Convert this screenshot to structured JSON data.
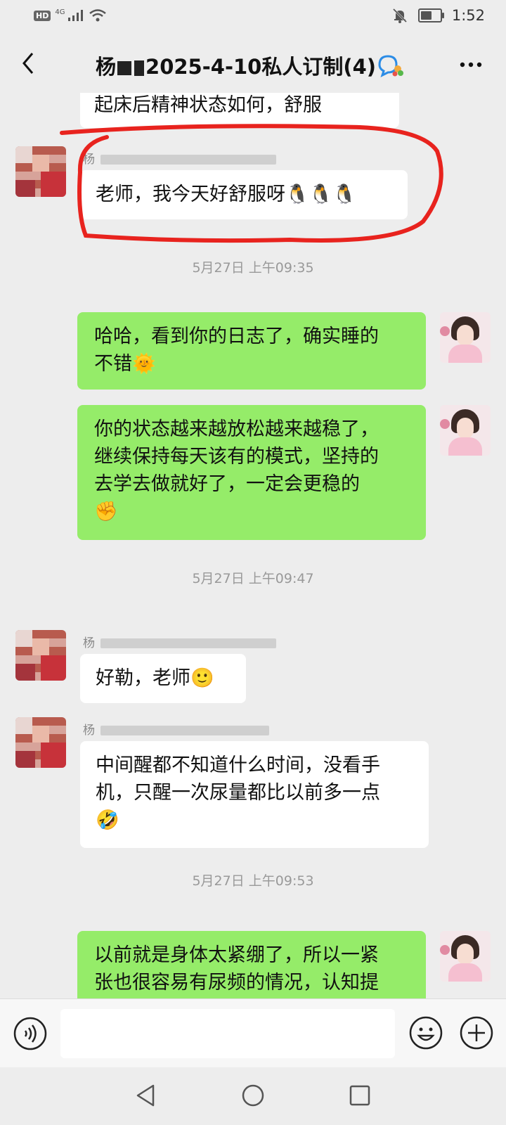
{
  "status_bar": {
    "hd": "HD",
    "network": "4G",
    "time": "1:52",
    "battery_level_pct": 60
  },
  "header": {
    "title_prefix": "杨",
    "title_suffix": "2025-4-10私人订制(4)",
    "icons": {
      "back": "chevron-left-icon",
      "group": "group-chat-icon",
      "more": "more-dots-icon"
    }
  },
  "messages": [
    {
      "side": "left",
      "text": "起床后精神状态如何，舒服"
    },
    {
      "side": "left",
      "sender": "杨",
      "text": "老师，我今天好舒服呀🐧🐧🐧"
    },
    {
      "type": "time",
      "text": "5月27日 上午09:35"
    },
    {
      "side": "right",
      "text": "哈哈，看到你的日志了，确实睡的\n不错🌞"
    },
    {
      "side": "right",
      "text": "你的状态越来越放松越来越稳了，\n继续保持每天该有的模式，坚持的\n去学去做就好了，一定会更稳的\n✊"
    },
    {
      "type": "time",
      "text": "5月27日 上午09:47"
    },
    {
      "side": "left",
      "sender": "杨",
      "text": "好勒，老师🙂"
    },
    {
      "side": "left",
      "sender": "杨",
      "text": "中间醒都不知道什么时间，没看手\n机，只醒一次尿量都比以前多一点\n🤣"
    },
    {
      "type": "time",
      "text": "5月27日 上午09:53"
    },
    {
      "side": "right",
      "text": "以前就是身体太紧绷了，所以一紧\n张也很容易有尿频的情况，认知提"
    }
  ],
  "annotation_color": "#e8231e",
  "colors": {
    "background": "#ededed",
    "incoming_bubble": "#ffffff",
    "outgoing_bubble": "#95ec69"
  },
  "input_bar": {
    "placeholder": "",
    "icons": [
      "voice-icon",
      "emoji-icon",
      "plus-icon"
    ]
  },
  "nav_bar": {
    "icons": [
      "nav-back-icon",
      "nav-home-icon",
      "nav-recent-icon"
    ]
  }
}
